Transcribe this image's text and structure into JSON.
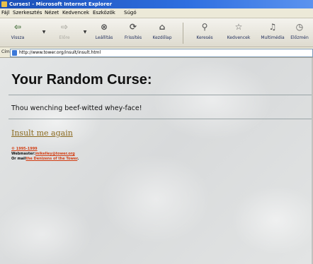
{
  "window": {
    "title": "Curses! - Microsoft Internet Explorer"
  },
  "menu": [
    "Fájl",
    "Szerkesztés",
    "Nézet",
    "Kedvencek",
    "Eszközök",
    "Súgó"
  ],
  "toolbar": {
    "back": "Vissza",
    "forward": "Előre",
    "stop": "Leállítás",
    "refresh": "Frissítés",
    "home": "Kezdőlap",
    "search": "Keresés",
    "favorites": "Kedvencek",
    "multimedia": "Multimédia",
    "history": "Előzmén"
  },
  "address": {
    "label": "Cím",
    "url": "http://www.tower.org/insult/insult.html"
  },
  "page": {
    "heading": "Your Random Curse:",
    "curse": "Thou wenching beef-witted whey-face!",
    "insult_again": "Insult me again",
    "copyright": "© 1995-1999",
    "webmaster_label": "Webmaster:",
    "webmaster_email": "mikelley@tower.org",
    "mail_label": "Or mail",
    "mail_link": "the Denizens of the Tower",
    "mail_suffix": "."
  },
  "colors": {
    "titlebar": "#2f6fe0",
    "link": "#8a6a1f",
    "small_link": "#d23d12"
  },
  "icons": [
    "ie-icon",
    "back-arrow-icon",
    "forward-arrow-icon",
    "stop-icon",
    "refresh-icon",
    "home-icon",
    "search-icon",
    "favorites-icon",
    "multimedia-icon",
    "history-icon",
    "page-icon"
  ]
}
